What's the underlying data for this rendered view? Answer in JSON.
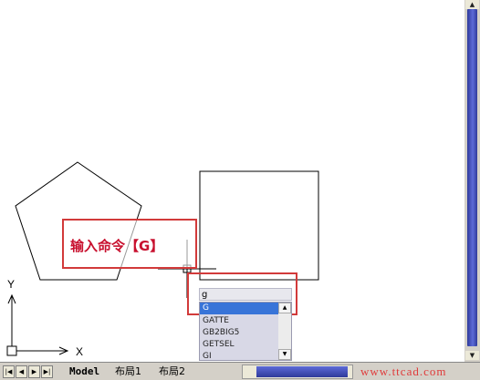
{
  "annotation": {
    "text": "输入命令【G】"
  },
  "command": {
    "typed_value": "g",
    "suggestions": [
      "G",
      "GATTE",
      "GB2BIG5",
      "GETSEL",
      "GI"
    ],
    "selected_index": 0
  },
  "ucs": {
    "x_label": "X",
    "y_label": "Y"
  },
  "tabs": {
    "model": "Model",
    "layout1": "布局1",
    "layout2": "布局2"
  },
  "nav": {
    "first": "|◀",
    "prev": "◀",
    "next": "▶",
    "last": "▶|"
  },
  "watermark": "www.ttcad.com",
  "colors": {
    "annotation_red": "#d23a3a",
    "selection_blue": "#3874d8",
    "scroll_blue": "#3f4cc0"
  }
}
